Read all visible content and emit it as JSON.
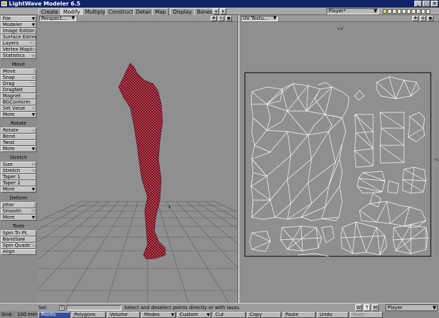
{
  "window": {
    "title": "LightWave Modeler 6.5",
    "controls": [
      "_",
      "□",
      "×"
    ]
  },
  "tabs": [
    {
      "label": "Create",
      "active": false
    },
    {
      "label": "Modify",
      "active": true
    },
    {
      "label": "Multiply",
      "active": false
    },
    {
      "label": "Construct",
      "active": false
    },
    {
      "label": "Detail",
      "active": false
    },
    {
      "label": "Map",
      "active": false
    },
    {
      "label": "Display",
      "active": false
    },
    {
      "label": "Bones",
      "active": false
    }
  ],
  "layer_select": {
    "value": "Player*",
    "arrow": "▼"
  },
  "sidebar": {
    "top": [
      {
        "label": "File",
        "hk": "▼",
        "dd": true
      },
      {
        "label": "Modeler",
        "hk": "▼",
        "dd": true
      },
      {
        "label": "Image Editor",
        "hk": "F6"
      },
      {
        "label": "Surface Editor",
        "hk": "F5"
      },
      {
        "label": "Layers",
        "hk": "F7"
      },
      {
        "label": "Vertex Maps",
        "hk": "F8"
      },
      {
        "label": "Statistics",
        "hk": "w"
      }
    ],
    "groups": [
      {
        "title": "Move",
        "items": [
          {
            "label": "Move",
            "hk": "t"
          },
          {
            "label": "Snap",
            "hk": "G"
          },
          {
            "label": "Drag",
            "hk": "^t"
          },
          {
            "label": "DragNet",
            "hk": ""
          },
          {
            "label": "Magnet",
            "hk": ""
          },
          {
            "label": "BGConform",
            "hk": ""
          },
          {
            "label": "Set Value",
            "hk": "V"
          },
          {
            "label": "More",
            "hk": "▼",
            "dd": true
          }
        ]
      },
      {
        "title": "Rotate",
        "items": [
          {
            "label": "Rotate",
            "hk": "y"
          },
          {
            "label": "Bend",
            "hk": ""
          },
          {
            "label": "Twist",
            "hk": ""
          },
          {
            "label": "More",
            "hk": "▼",
            "dd": true
          }
        ]
      },
      {
        "title": "Stretch",
        "items": [
          {
            "label": "Size",
            "hk": "H"
          },
          {
            "label": "Stretch",
            "hk": "h"
          },
          {
            "label": "Taper 1",
            "hk": ""
          },
          {
            "label": "Taper 2",
            "hk": ""
          },
          {
            "label": "More",
            "hk": "▼",
            "dd": true
          }
        ]
      },
      {
        "title": "Deform",
        "items": [
          {
            "label": "Jitter",
            "hk": "J"
          },
          {
            "label": "Smooth",
            "hk": "M"
          },
          {
            "label": "More",
            "hk": "▼",
            "dd": true
          }
        ]
      },
      {
        "title": "Tools",
        "items": [
          {
            "label": "Spin Tri Pt.",
            "hk": ""
          },
          {
            "label": "BandSaw",
            "hk": ""
          },
          {
            "label": "Spin Quads",
            "hk": "^k"
          },
          {
            "label": "Align",
            "hk": ""
          }
        ]
      }
    ]
  },
  "viewports": {
    "left": {
      "view": "Perspect...",
      "arrow": "▼"
    },
    "right": {
      "view": "UV Textu...",
      "arrow": "▼",
      "axis_top": "+V",
      "axis_right": "+U"
    }
  },
  "status": {
    "sel_label": "Sel:",
    "sel_value": "0",
    "hint": "Select and deselect points directly or with lasso.",
    "wtm": [
      "W",
      "T",
      "M"
    ],
    "wtm_active": "T",
    "vmap": "Player"
  },
  "bottom": {
    "grid_label": "Grid:",
    "grid_value": "100 mm",
    "modes": [
      {
        "label": "Points",
        "state": "active",
        "arrow": ""
      },
      {
        "label": "Polygons",
        "state": "",
        "arrow": ""
      },
      {
        "label": "Volume",
        "state": "",
        "arrow": ""
      },
      {
        "label": "Modes",
        "state": "",
        "arrow": "▼"
      },
      {
        "label": "Custom",
        "state": "",
        "arrow": "▼"
      },
      {
        "label": "Cut",
        "state": "",
        "arrow": ""
      },
      {
        "label": "Copy",
        "state": "",
        "arrow": ""
      },
      {
        "label": "Paste",
        "state": "",
        "arrow": ""
      },
      {
        "label": "Undo",
        "state": "",
        "arrow": ""
      },
      {
        "label": "Redo",
        "state": "disabled",
        "arrow": ""
      }
    ]
  },
  "colors": {
    "mesh": "#b83040",
    "uv_wire": "#ffffff",
    "grid": "#5a5a5a",
    "active_mode": "#3050a8"
  }
}
